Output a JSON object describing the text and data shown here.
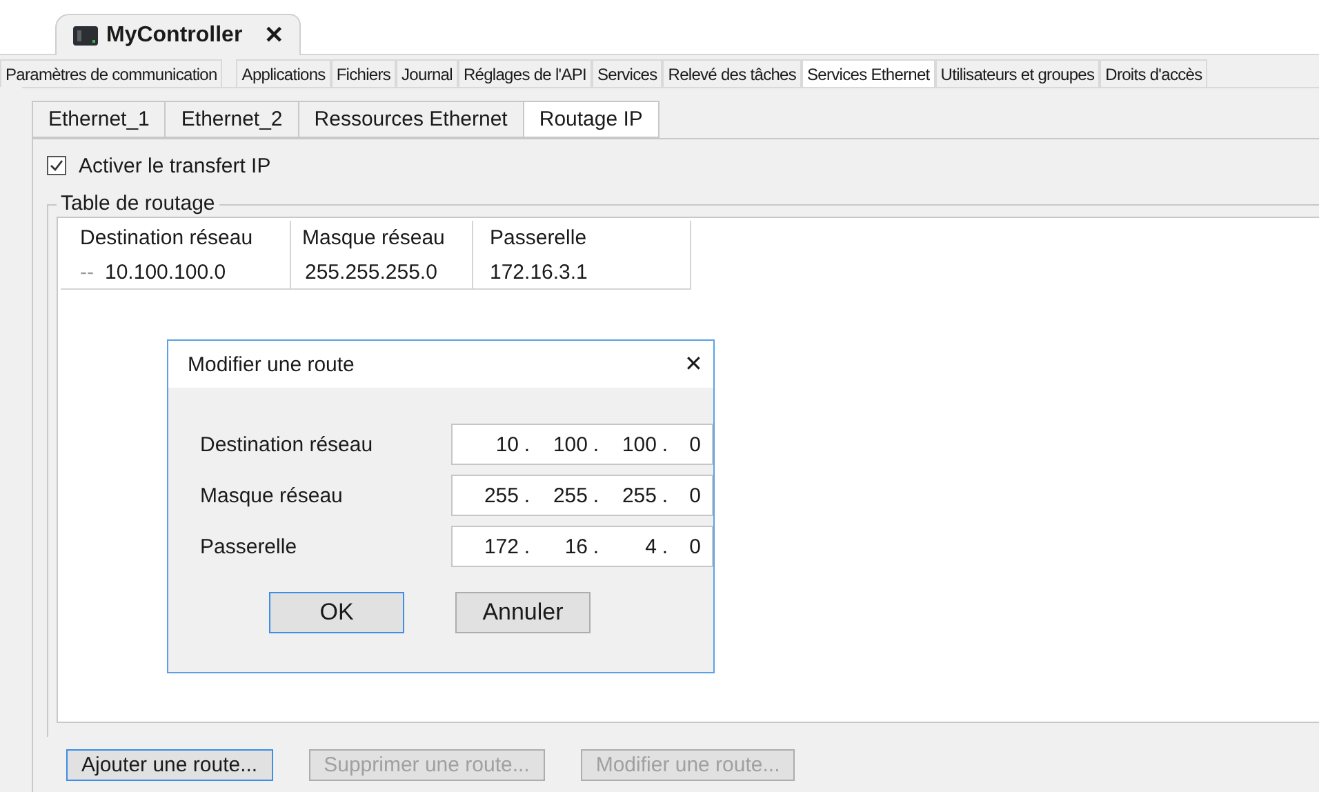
{
  "document_tab": {
    "title": "MyController",
    "close": "✕"
  },
  "tabs": [
    {
      "label": "Paramètres de communication",
      "selected": false
    },
    {
      "label": "Applications",
      "selected": false
    },
    {
      "label": "Fichiers",
      "selected": false
    },
    {
      "label": "Journal",
      "selected": false
    },
    {
      "label": "Réglages de l'API",
      "selected": false
    },
    {
      "label": "Services",
      "selected": false
    },
    {
      "label": "Relevé des tâches",
      "selected": false
    },
    {
      "label": "Services Ethernet",
      "selected": true
    },
    {
      "label": "Utilisateurs et groupes",
      "selected": false
    },
    {
      "label": "Droits d'accès",
      "selected": false
    }
  ],
  "sub_tabs": [
    {
      "label": "Ethernet_1",
      "selected": false
    },
    {
      "label": "Ethernet_2",
      "selected": false
    },
    {
      "label": "Ressources Ethernet",
      "selected": false
    },
    {
      "label": "Routage IP",
      "selected": true
    }
  ],
  "ip_forwarding": {
    "label": "Activer le transfert IP",
    "checked": true
  },
  "routing_table": {
    "title": "Table de routage",
    "columns": [
      "Destination réseau",
      "Masque réseau",
      "Passerelle"
    ],
    "rows": [
      {
        "marker": "--",
        "cells": [
          "10.100.100.0",
          "255.255.255.0",
          "172.16.3.1"
        ]
      }
    ]
  },
  "buttons": [
    {
      "label": "Ajouter une route...",
      "disabled": false,
      "focused": true
    },
    {
      "label": "Supprimer une route...",
      "disabled": true,
      "focused": false
    },
    {
      "label": "Modifier une route...",
      "disabled": true,
      "focused": false
    }
  ],
  "dialog": {
    "title": "Modifier une route",
    "close": "✕",
    "fields": [
      {
        "label": "Destination réseau",
        "separator": ".",
        "octets": [
          "10",
          "100",
          "100",
          "0"
        ]
      },
      {
        "label": "Masque réseau",
        "separator": ".",
        "octets": [
          "255",
          "255",
          "255",
          "0"
        ]
      },
      {
        "label": "Passerelle",
        "separator": ".",
        "octets": [
          "172",
          "16",
          "4",
          "0"
        ]
      }
    ],
    "buttons": [
      {
        "label": "OK",
        "focused": true
      },
      {
        "label": "Annuler",
        "focused": false
      }
    ]
  }
}
